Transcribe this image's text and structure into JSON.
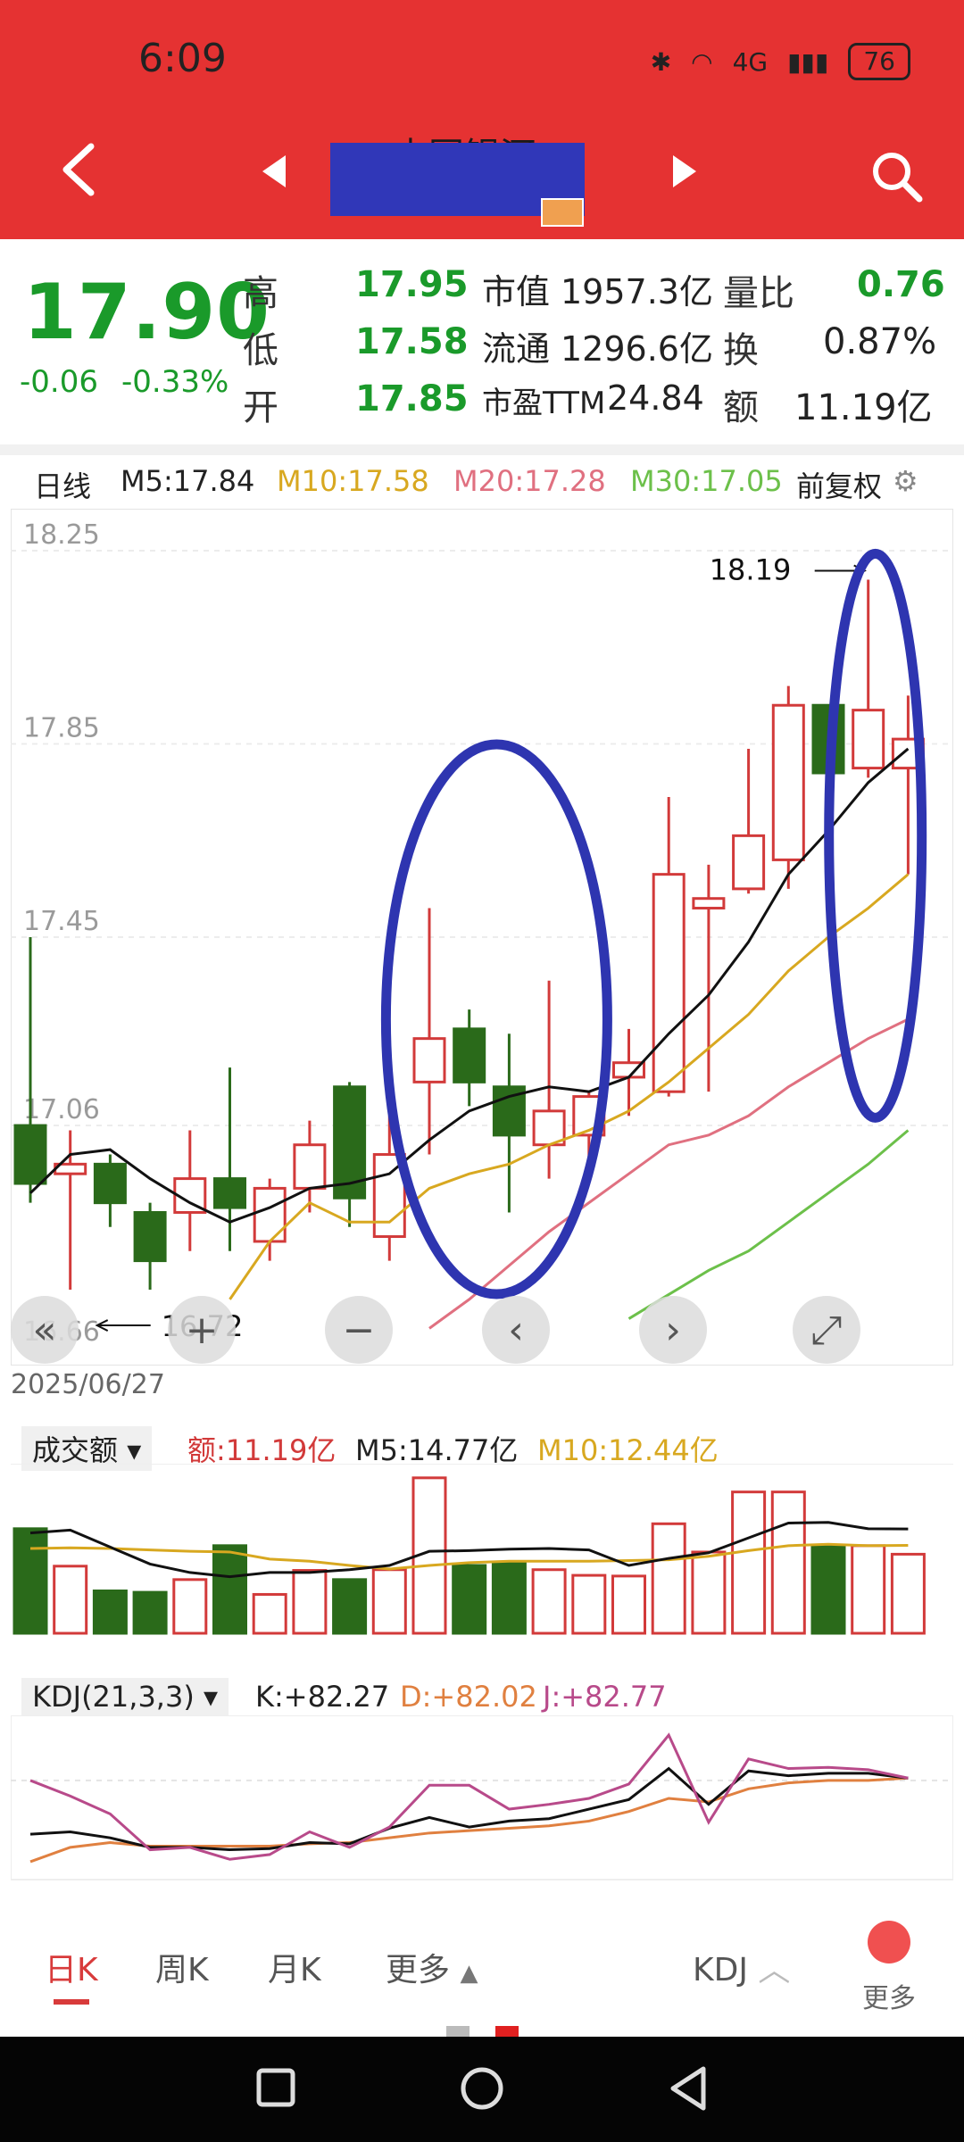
{
  "status": {
    "time": "6:09",
    "network": "4G",
    "battery": "76"
  },
  "header": {
    "stock_name": "中国银河"
  },
  "quote": {
    "price": "17.90",
    "change": "-0.06",
    "change_pct": "-0.33%",
    "rows": [
      {
        "l1": "高",
        "v1": "17.95",
        "l2": "市值",
        "v2": "1957.3亿",
        "l3": "量比",
        "v3": "0.76"
      },
      {
        "l1": "低",
        "v1": "17.58",
        "l2": "流通",
        "v2": "1296.6亿",
        "l3": "换",
        "v3": "0.87%"
      },
      {
        "l1": "开",
        "v1": "17.85",
        "l2": "市盈TTM",
        "v2": "24.84",
        "l3": "额",
        "v3": "11.19亿"
      }
    ]
  },
  "ma": {
    "period": "日线",
    "m5": "M5:17.84",
    "m10": "M10:17.58",
    "m20": "M20:17.28",
    "m30": "M30:17.05",
    "adjust": "前复权"
  },
  "colors": {
    "up": "#d23a3a",
    "down": "#2a6a1a",
    "m5": "#111111",
    "m10": "#d8a820",
    "m20": "#e07080",
    "m30": "#6cc04a",
    "annot": "#2e35b0",
    "brand": "#e53232"
  },
  "chart_data": {
    "type": "candlestick",
    "ylim": [
      16.6,
      18.3
    ],
    "yticks": [
      "18.25",
      "17.85",
      "17.45",
      "17.06"
    ],
    "bottom_tick": "16.66",
    "date": "2025/06/27",
    "high_marker": "18.19",
    "low_marker": "16.72",
    "candles": [
      {
        "o": 17.06,
        "c": 16.94,
        "h": 17.45,
        "l": 16.9
      },
      {
        "o": 16.96,
        "c": 16.98,
        "h": 17.05,
        "l": 16.72
      },
      {
        "o": 16.98,
        "c": 16.9,
        "h": 17.0,
        "l": 16.85
      },
      {
        "o": 16.88,
        "c": 16.78,
        "h": 16.9,
        "l": 16.72
      },
      {
        "o": 16.88,
        "c": 16.95,
        "h": 17.05,
        "l": 16.8
      },
      {
        "o": 16.95,
        "c": 16.89,
        "h": 17.18,
        "l": 16.8
      },
      {
        "o": 16.82,
        "c": 16.93,
        "h": 16.95,
        "l": 16.78
      },
      {
        "o": 16.93,
        "c": 17.02,
        "h": 17.07,
        "l": 16.88
      },
      {
        "o": 17.14,
        "c": 16.91,
        "h": 17.15,
        "l": 16.85
      },
      {
        "o": 16.83,
        "c": 17.0,
        "h": 17.08,
        "l": 16.78
      },
      {
        "o": 17.15,
        "c": 17.24,
        "h": 17.51,
        "l": 17.0
      },
      {
        "o": 17.26,
        "c": 17.15,
        "h": 17.3,
        "l": 17.1
      },
      {
        "o": 17.14,
        "c": 17.04,
        "h": 17.25,
        "l": 16.88
      },
      {
        "o": 17.02,
        "c": 17.09,
        "h": 17.36,
        "l": 16.95
      },
      {
        "o": 17.04,
        "c": 17.12,
        "h": 17.13,
        "l": 16.95
      },
      {
        "o": 17.16,
        "c": 17.19,
        "h": 17.26,
        "l": 17.08
      },
      {
        "o": 17.13,
        "c": 17.58,
        "h": 17.74,
        "l": 17.12
      },
      {
        "o": 17.51,
        "c": 17.53,
        "h": 17.6,
        "l": 17.13
      },
      {
        "o": 17.55,
        "c": 17.66,
        "h": 17.84,
        "l": 17.54
      },
      {
        "o": 17.61,
        "c": 17.93,
        "h": 17.97,
        "l": 17.55
      },
      {
        "o": 17.93,
        "c": 17.79,
        "h": 17.93,
        "l": 17.79
      },
      {
        "o": 17.8,
        "c": 17.92,
        "h": 18.19,
        "l": 17.78
      },
      {
        "o": 17.8,
        "c": 17.86,
        "h": 17.95,
        "l": 17.58
      }
    ],
    "m5": [
      16.92,
      17.0,
      17.01,
      16.95,
      16.9,
      16.86,
      16.89,
      16.93,
      16.94,
      16.96,
      17.03,
      17.09,
      17.12,
      17.14,
      17.13,
      17.16,
      17.25,
      17.33,
      17.44,
      17.58,
      17.67,
      17.77,
      17.84
    ],
    "m10": [
      null,
      null,
      null,
      null,
      null,
      16.7,
      16.82,
      16.9,
      16.86,
      16.86,
      16.93,
      16.96,
      16.98,
      17.02,
      17.05,
      17.09,
      17.15,
      17.22,
      17.29,
      17.38,
      17.45,
      17.51,
      17.58
    ],
    "m20": [
      null,
      null,
      null,
      null,
      null,
      null,
      null,
      null,
      null,
      null,
      16.64,
      16.7,
      16.77,
      16.84,
      16.9,
      16.96,
      17.02,
      17.04,
      17.08,
      17.14,
      17.19,
      17.24,
      17.28
    ],
    "m30": [
      null,
      null,
      null,
      null,
      null,
      null,
      null,
      null,
      null,
      null,
      null,
      null,
      null,
      null,
      null,
      16.66,
      16.71,
      16.76,
      16.8,
      16.86,
      16.92,
      16.98,
      17.05
    ]
  },
  "volume": {
    "label": "成交额",
    "amount": "额:11.19亿",
    "m5": "M5:14.77亿",
    "m10": "M10:12.44亿",
    "bars": [
      14.8,
      9.5,
      6.0,
      5.8,
      7.6,
      12.4,
      5.5,
      8.9,
      7.6,
      9.0,
      22.0,
      9.6,
      10.0,
      9.0,
      8.2,
      8.1,
      15.5,
      11.5,
      20.0,
      20.0,
      12.4,
      12.4,
      11.19
    ],
    "m5_line": [
      14.2,
      14.6,
      12.2,
      9.8,
      8.6,
      8.0,
      8.6,
      8.6,
      9.0,
      9.6,
      11.6,
      11.7,
      11.9,
      12.0,
      11.8,
      9.6,
      10.6,
      11.4,
      13.5,
      15.6,
      15.7,
      14.8,
      14.77
    ],
    "m10_line": [
      12.0,
      12.1,
      12.0,
      11.8,
      11.6,
      11.5,
      10.5,
      10.2,
      9.6,
      9.1,
      9.6,
      10.0,
      10.2,
      10.2,
      10.2,
      10.3,
      10.4,
      10.9,
      11.7,
      12.4,
      12.6,
      12.4,
      12.44
    ]
  },
  "kdj": {
    "label": "KDJ(21,3,3)",
    "k": "K:+82.27",
    "d": "D:+82.02",
    "j": "J:+82.77",
    "k_line": [
      35,
      37,
      32,
      24,
      24,
      22,
      23,
      28,
      27,
      40,
      49,
      41,
      46,
      48,
      56,
      64,
      90,
      60,
      88,
      84,
      86,
      86,
      82
    ],
    "d_line": [
      12,
      24,
      28,
      25,
      25,
      25,
      25,
      27,
      28,
      32,
      36,
      38,
      40,
      42,
      46,
      54,
      65,
      62,
      73,
      78,
      80,
      80,
      82
    ],
    "j_line": [
      80,
      67,
      52,
      22,
      24,
      14,
      18,
      37,
      24,
      41,
      76,
      76,
      56,
      60,
      65,
      77,
      118,
      45,
      98,
      90,
      91,
      89,
      82
    ]
  },
  "bottom_tabs": [
    "日K",
    "周K",
    "月K",
    "更多"
  ],
  "bottom_right": {
    "indicator": "KDJ",
    "more": "更多"
  }
}
